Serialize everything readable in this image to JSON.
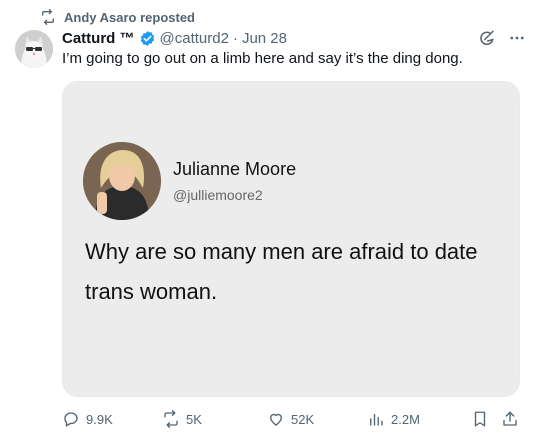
{
  "repost": {
    "label": "Andy Asaro reposted"
  },
  "tweet": {
    "display_name": "Catturd ™",
    "handle": "@catturd2",
    "separator": "·",
    "date": "Jun 28",
    "text": "I’m going to go out on a limb here and say it’s the ding dong."
  },
  "embedded": {
    "name": "Julianne Moore",
    "handle": "@julliemoore2",
    "text": "Why are so many men are afraid to date trans woman."
  },
  "actions": {
    "replies": "9.9K",
    "reposts": "5K",
    "likes": "52K",
    "views": "2.2M"
  },
  "colors": {
    "verified": "#1d9bf0",
    "muted": "#536471",
    "text": "#0f1419",
    "card_bg": "#ececec"
  },
  "icons": [
    "repost-icon",
    "verified-badge-icon",
    "grok-icon",
    "more-icon",
    "reply-icon",
    "like-icon",
    "views-icon",
    "bookmark-icon",
    "share-icon"
  ]
}
